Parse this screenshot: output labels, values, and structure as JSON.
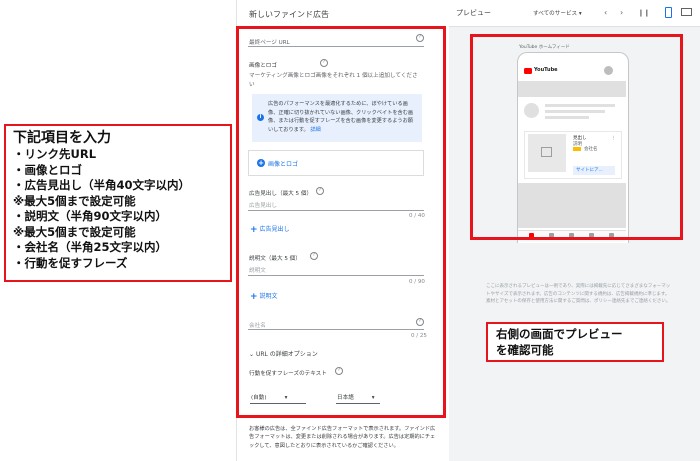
{
  "annotations": {
    "left_heading": "下記項目を入力",
    "left_lines": [
      "・リンク先URL",
      "・画像とロゴ",
      "・広告見出し（半角40文字以内）",
      "※最大5個まで設定可能",
      "・説明文（半角90文字以内）",
      "※最大5個まで設定可能",
      "・会社名（半角25文字以内）",
      "・行動を促すフレーズ"
    ],
    "right_lines": [
      "右側の画面でプレビュー",
      "を確認可能"
    ]
  },
  "form": {
    "title": "新しいファインド広告",
    "final_url_label": "最終ページ URL",
    "images_section_title": "画像とロゴ",
    "images_section_desc": "マーケティング画像とロゴ画像をそれぞれ 1 個以上追加してください",
    "info_text": "広告のパフォーマンスを最適化するために、ぼやけている画像、正確に切り抜かれていない画像、クリックベイトを含む画像、または行動を促すフレーズを含む画像を変更するようお願いしております。",
    "info_link": "詳細",
    "images_logo_button": "画像とロゴ",
    "headline_label": "広告見出し（最大 5 個）",
    "headline_placeholder": "広告見出し",
    "headline_count": "0 / 40",
    "add_headline": "広告見出し",
    "description_label": "説明文（最大 5 個）",
    "description_placeholder": "説明文",
    "description_count": "0 / 90",
    "add_description": "説明文",
    "company_placeholder": "会社名",
    "company_count": "0 / 25",
    "url_options": "URL の詳細オプション",
    "cta_label": "行動を促すフレーズのテキスト",
    "cta_value": "(自動)",
    "lang_value": "日本語",
    "footer_note": "お客様の広告は、全ファインド広告フォーマットで表示されます。ファインド広告フォーマットは、変更または削除される場合があります。広告は定期的にチェックして、意図したとおりに表示されているかご確認ください。"
  },
  "preview": {
    "title": "プレビュー",
    "service_select": "すべてのサービス",
    "phone_caption": "YouTube ホームフィード",
    "yt_label": "YouTube",
    "ad_title": "見出し",
    "ad_sub1": "説明",
    "ad_sub2": "会社名",
    "cta_text": "サイトにア...",
    "note": "ここに表示されるプレビューは一例であり、実際には掲載先に応じてさまざまなフォーマットやサイズで表示されます。広告のコンテンツに関する規約は、広告掲載規約に準じます。素材とアセットの保存と使用方法に関するご質問は、ポリシー連絡先までご連絡ください。"
  },
  "colors": {
    "annotation_red": "#e8141b",
    "link_blue": "#1a73e8",
    "youtube_red": "#ff0000"
  }
}
